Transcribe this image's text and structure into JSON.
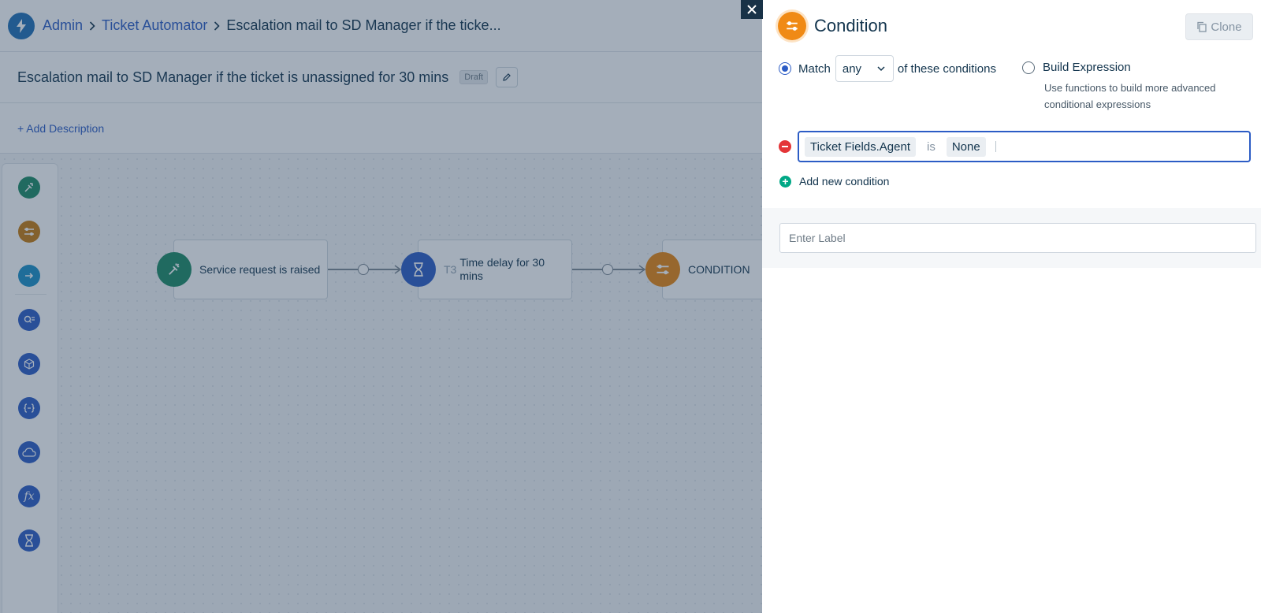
{
  "breadcrumb": {
    "items": [
      "Admin",
      "Ticket Automator"
    ],
    "current": "Escalation mail to SD Manager if the ticke..."
  },
  "workflow": {
    "title": "Escalation mail to SD Manager if the ticket is unassigned for 30 mins",
    "status_badge": "Draft",
    "add_description": "+ Add Description"
  },
  "canvas": {
    "nodes": [
      {
        "label": "Service request is raised",
        "prefix": "",
        "icon": "trigger-icon",
        "color": "#1d8a64"
      },
      {
        "label": "Time delay for 30 mins",
        "prefix": "T3",
        "icon": "hourglass-icon",
        "color": "#2c5cc5"
      },
      {
        "label": "CONDITION",
        "prefix": "",
        "icon": "condition-icon",
        "color": "#e8850e"
      }
    ]
  },
  "palette": {
    "items": [
      {
        "name": "event-icon",
        "color": "#1d8a64"
      },
      {
        "name": "condition-icon",
        "color": "#c77a0e"
      },
      {
        "name": "action-icon",
        "color": "#1a8fc6"
      },
      {
        "name": "search-list-icon",
        "color": "#2c5cc5"
      },
      {
        "name": "app-cube-icon",
        "color": "#2c5cc5"
      },
      {
        "name": "expression-icon",
        "color": "#2c5cc5"
      },
      {
        "name": "api-cloud-icon",
        "color": "#2c5cc5"
      },
      {
        "name": "function-icon",
        "color": "#2c5cc5"
      },
      {
        "name": "timer-icon",
        "color": "#2c5cc5"
      }
    ]
  },
  "panel": {
    "title": "Condition",
    "clone_label": "Clone",
    "match_label": "Match",
    "match_value": "any",
    "match_suffix": "of these conditions",
    "build_expression_label": "Build Expression",
    "build_expression_help": "Use functions to build more advanced conditional expressions",
    "condition": {
      "field": "Ticket Fields.Agent",
      "operator": "is",
      "value": "None"
    },
    "add_condition_label": "Add new condition",
    "label_placeholder": "Enter Label"
  },
  "colors": {
    "accent": "#2c5cc5",
    "condition_orange": "#f08a15",
    "danger": "#e43538",
    "success": "#00a886"
  }
}
